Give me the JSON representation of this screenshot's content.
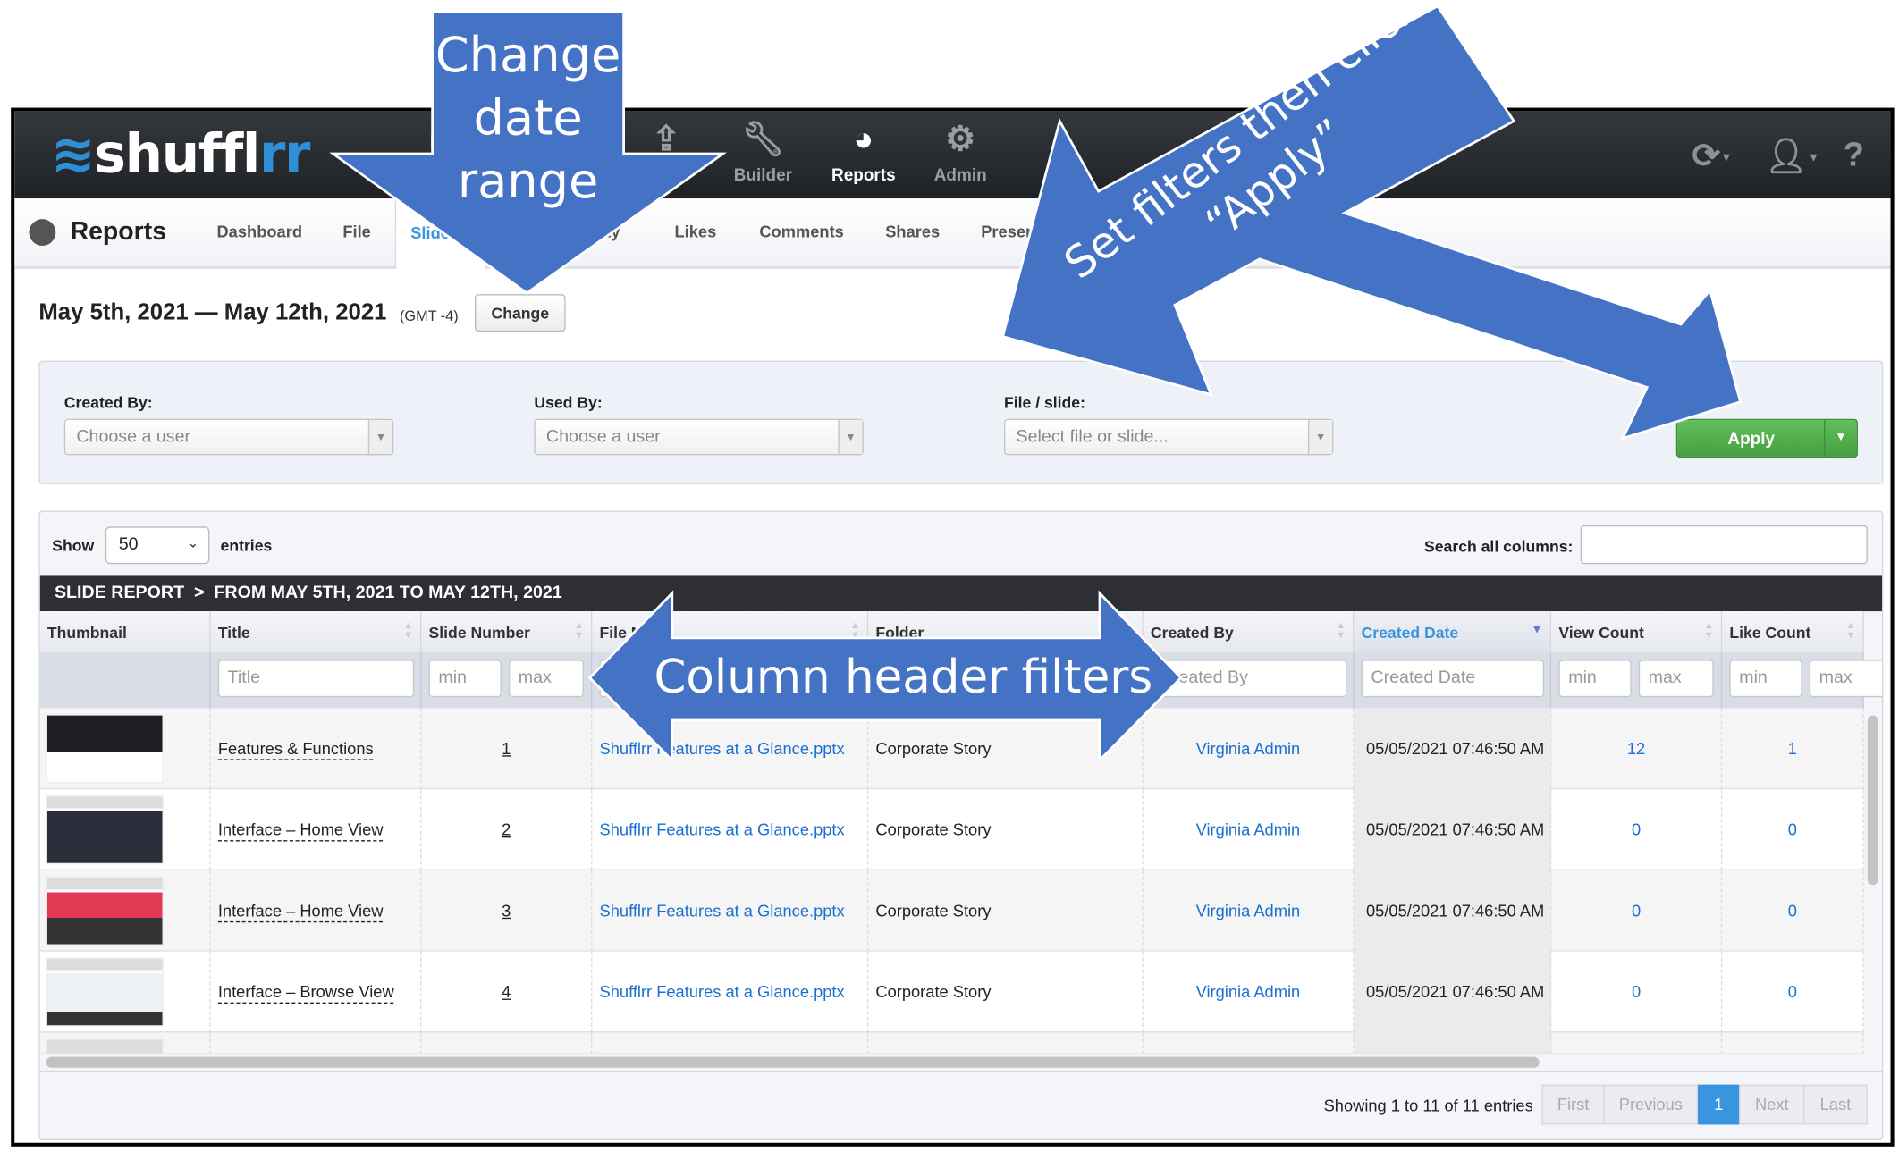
{
  "app": {
    "brand_main": "shuffl",
    "brand_accent": "rr"
  },
  "topnav": {
    "items": [
      {
        "label": "Builder",
        "icon": "wrench-icon"
      },
      {
        "label": "Reports",
        "icon": "pie-chart-icon",
        "active": true
      },
      {
        "label": "Admin",
        "icon": "gear-icon"
      }
    ],
    "right_icons": [
      "refresh-icon",
      "user-icon",
      "help-icon"
    ],
    "help_glyph": "?"
  },
  "subnav": {
    "title": "Reports",
    "tabs": [
      {
        "label": "Dashboard"
      },
      {
        "label": "File"
      },
      {
        "label": "Slides",
        "active": true,
        "visible": "Slid"
      },
      {
        "label": "ty"
      },
      {
        "label": "Likes"
      },
      {
        "label": "Comments"
      },
      {
        "label": "Shares"
      },
      {
        "label": "Presen"
      }
    ]
  },
  "daterange": {
    "text": "May 5th, 2021 — May 12th, 2021",
    "timezone": "(GMT -4)",
    "change_label": "Change"
  },
  "filters": {
    "created_by": {
      "label": "Created By:",
      "placeholder": "Choose a user"
    },
    "used_by": {
      "label": "Used By:",
      "placeholder": "Choose a user"
    },
    "file_slide": {
      "label": "File / slide:",
      "placeholder": "Select file or slide..."
    },
    "apply_label": "Apply"
  },
  "table": {
    "show_label": "Show",
    "entries_label": "entries",
    "page_length": "50",
    "search_label": "Search all columns:",
    "search_value": "",
    "title_bar": "SLIDE REPORT  >  FROM MAY 5TH, 2021 TO MAY 12TH, 2021",
    "columns": [
      "Thumbnail",
      "Title",
      "Slide Number",
      "File N",
      "Folder",
      "Created By",
      "Created Date",
      "View Count",
      "Like Count"
    ],
    "sorted_column": "Created Date",
    "filter_placeholders": {
      "title": "Title",
      "min": "min",
      "max": "max",
      "created_by": "Created By",
      "created_date": "Created Date"
    },
    "rows": [
      {
        "title": "Features & Functions",
        "slide": "1",
        "file": "Shufflrr Features at a Glance.pptx",
        "folder": "Corporate Story",
        "created_by": "Virginia Admin",
        "created_date": "05/05/2021 07:46:50 AM",
        "views": "12",
        "likes": "1"
      },
      {
        "title": "Interface – Home View",
        "slide": "2",
        "file": "Shufflrr Features at a Glance.pptx",
        "folder": "Corporate Story",
        "created_by": "Virginia Admin",
        "created_date": "05/05/2021 07:46:50 AM",
        "views": "0",
        "likes": "0"
      },
      {
        "title": "Interface – Home View",
        "slide": "3",
        "file": "Shufflrr Features at a Glance.pptx",
        "folder": "Corporate Story",
        "created_by": "Virginia Admin",
        "created_date": "05/05/2021 07:46:50 AM",
        "views": "0",
        "likes": "0"
      },
      {
        "title": "Interface – Browse View",
        "slide": "4",
        "file": "Shufflrr Features at a Glance.pptx",
        "folder": "Corporate Story",
        "created_by": "Virginia Admin",
        "created_date": "05/05/2021 07:46:50 AM",
        "views": "0",
        "likes": "0"
      }
    ],
    "showing": "Showing 1 to 11 of 11 entries",
    "pager": [
      "First",
      "Previous",
      "1",
      "Next",
      "Last"
    ]
  },
  "annotations": {
    "change_date": [
      "Change",
      "date",
      "range"
    ],
    "set_filters": [
      "Set filters then click",
      "“Apply”"
    ],
    "column_filters": "Column header filters",
    "color": "#4472c4"
  },
  "colors": {
    "accent": "#3a95e0",
    "link": "#1a6fd1",
    "apply": "#4fae48",
    "nav_bg": "#2a2d31"
  }
}
